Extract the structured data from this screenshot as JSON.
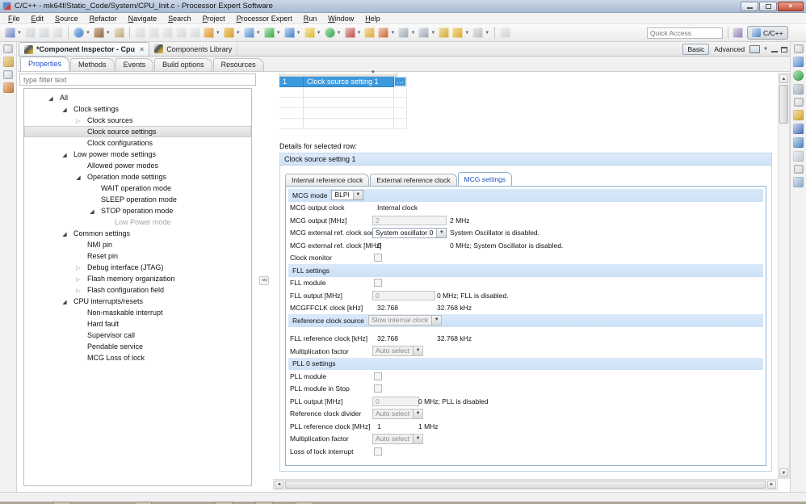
{
  "window": {
    "title": "C/C++ - mk64f/Static_Code/System/CPU_Init.c - Processor Expert Software"
  },
  "menu": {
    "items": [
      "File",
      "Edit",
      "Source",
      "Refactor",
      "Navigate",
      "Search",
      "Project",
      "Processor Expert",
      "Run",
      "Window",
      "Help"
    ]
  },
  "toolbar": {
    "quick_access_placeholder": "Quick Access",
    "perspective_label": "C/C++",
    "items": [
      {
        "name": "new-wizard",
        "dropdown": true
      },
      {
        "name": "save",
        "dim": true
      },
      {
        "name": "save-all",
        "dim": true
      },
      {
        "name": "print",
        "dim": true
      },
      {
        "sep": true
      },
      {
        "name": "debug-attach",
        "dropdown": true
      },
      {
        "name": "build",
        "dropdown": true
      },
      {
        "name": "make-target"
      },
      {
        "sep": true
      },
      {
        "name": "pencil",
        "dim": true
      },
      {
        "name": "format-brush",
        "dim": true
      },
      {
        "name": "spray",
        "dim": true
      },
      {
        "name": "mark-occurrences",
        "dim": true
      },
      {
        "name": "show-whitespace",
        "dim": true
      },
      {
        "name": "new-pe-project",
        "dropdown": true
      },
      {
        "name": "toolbox",
        "dropdown": true
      },
      {
        "name": "new-c-file",
        "dropdown": true
      },
      {
        "name": "coverage",
        "dropdown": true
      },
      {
        "name": "annotations",
        "dropdown": true
      },
      {
        "name": "external-tools",
        "dropdown": true
      },
      {
        "name": "run",
        "dropdown": true
      },
      {
        "name": "profile",
        "dropdown": true
      },
      {
        "name": "open-resource"
      },
      {
        "name": "highlighter",
        "dropdown": true
      },
      {
        "name": "prev-annotation",
        "dropdown": true
      },
      {
        "name": "next-annotation",
        "dropdown": true
      },
      {
        "name": "last-edit"
      },
      {
        "name": "back",
        "dropdown": true
      },
      {
        "name": "forward",
        "dropdown": true
      },
      {
        "sep": true
      },
      {
        "name": "pin-editor",
        "dim": true
      }
    ]
  },
  "left_strip": {
    "icons": [
      "restore-view",
      "project-explorer",
      "restore-view",
      "type-hierarchy"
    ]
  },
  "right_strip": {
    "icons": [
      "restore-view",
      "outline-view",
      "target-connections",
      "device-view",
      "restore-view",
      "problems-view",
      "tasks-view",
      "console-view",
      "memory-view",
      "restore-view",
      "split-editor"
    ]
  },
  "editor_tabs": [
    {
      "label": "*Component Inspector - Cpu",
      "active": true,
      "closable": true
    },
    {
      "label": "Components Library",
      "active": false,
      "closable": false
    }
  ],
  "view_toolbar": {
    "basic_label": "Basic",
    "advanced_label": "Advanced"
  },
  "inspector_tabs": [
    {
      "label": "Properties",
      "active": true
    },
    {
      "label": "Methods"
    },
    {
      "label": "Events"
    },
    {
      "label": "Build options"
    },
    {
      "label": "Resources"
    }
  ],
  "filter": {
    "placeholder": "type filter text"
  },
  "tree": {
    "items": [
      {
        "label": "All",
        "level": 0,
        "state": "expanded"
      },
      {
        "label": "Clock settings",
        "level": 1,
        "state": "expanded"
      },
      {
        "label": "Clock sources",
        "level": 2,
        "state": "collapsed"
      },
      {
        "label": "Clock source settings",
        "level": 2,
        "state": "leaf",
        "selected": true
      },
      {
        "label": "Clock configurations",
        "level": 2,
        "state": "leaf"
      },
      {
        "label": "Low power mode settings",
        "level": 1,
        "state": "expanded"
      },
      {
        "label": "Allowed power modes",
        "level": 2,
        "state": "leaf"
      },
      {
        "label": "Operation mode settings",
        "level": 2,
        "state": "expanded"
      },
      {
        "label": "WAIT operation mode",
        "level": 3,
        "state": "leaf"
      },
      {
        "label": "SLEEP operation mode",
        "level": 3,
        "state": "leaf"
      },
      {
        "label": "STOP operation mode",
        "level": 3,
        "state": "expanded"
      },
      {
        "label": "Low Power mode",
        "level": 4,
        "state": "leaf",
        "disabled": true
      },
      {
        "label": "Common settings",
        "level": 1,
        "state": "expanded"
      },
      {
        "label": "NMI pin",
        "level": 2,
        "state": "leaf"
      },
      {
        "label": "Reset pin",
        "level": 2,
        "state": "leaf"
      },
      {
        "label": "Debug interface (JTAG)",
        "level": 2,
        "state": "collapsed"
      },
      {
        "label": "Flash memory organization",
        "level": 2,
        "state": "collapsed"
      },
      {
        "label": "Flash configuration field",
        "level": 2,
        "state": "collapsed"
      },
      {
        "label": "CPU interrupts/resets",
        "level": 1,
        "state": "expanded"
      },
      {
        "label": "Non-maskable interrupt",
        "level": 2,
        "state": "leaf"
      },
      {
        "label": "Hard fault",
        "level": 2,
        "state": "leaf"
      },
      {
        "label": "Supervisor call",
        "level": 2,
        "state": "leaf"
      },
      {
        "label": "Pendable service",
        "level": 2,
        "state": "leaf"
      },
      {
        "label": "MCG Loss of lock",
        "level": 2,
        "state": "leaf"
      }
    ]
  },
  "grid": {
    "row": {
      "num": "1",
      "name": "Clock source setting 1",
      "more_label": "…"
    }
  },
  "splitter": {
    "collapse_label": "<<"
  },
  "details": {
    "caption": "Details for selected row:",
    "group_title": "Clock source setting 1",
    "tabs": [
      {
        "label": "Internal reference clock"
      },
      {
        "label": "External reference clock"
      },
      {
        "label": "MCG settings",
        "active": true
      }
    ],
    "rows": [
      {
        "type": "header-select",
        "label": "MCG mode",
        "value": "BLPI",
        "disabled": false
      },
      {
        "type": "text",
        "label": "MCG output clock",
        "value": "Internal clock",
        "comment": ""
      },
      {
        "type": "input",
        "label": "MCG output [MHz]",
        "value": "2",
        "comment": "2 MHz",
        "disabled": true
      },
      {
        "type": "select",
        "label": "MCG external ref. clock source",
        "value": "System oscillator 0",
        "comment": "System Oscillator is disabled.",
        "disabled": false
      },
      {
        "type": "text",
        "label": "MCG external ref. clock [MHz]",
        "value": "0",
        "comment": "0 MHz; System Oscillator is disabled."
      },
      {
        "type": "checkbox",
        "label": "Clock monitor",
        "checked": false
      },
      {
        "type": "section",
        "label": "FLL settings"
      },
      {
        "type": "checkbox",
        "label": "FLL module",
        "checked": false
      },
      {
        "type": "input",
        "label": "FLL output [MHz]",
        "value": "0",
        "comment": "0 MHz; FLL is disabled.",
        "disabled": true
      },
      {
        "type": "text",
        "label": "MCGFFCLK clock [kHz]",
        "value": "32.768",
        "comment": "32.768 kHz"
      },
      {
        "type": "header-select",
        "label": "Reference clock source",
        "value": "Slow internal clock",
        "disabled": true
      },
      {
        "type": "text",
        "label": "FLL reference clock [kHz]",
        "value": "32.768",
        "comment": "32.768 kHz"
      },
      {
        "type": "select",
        "label": "Multiplication factor",
        "value": "Auto select",
        "comment": "",
        "disabled": true
      },
      {
        "type": "section",
        "label": "PLL 0 settings"
      },
      {
        "type": "checkbox",
        "label": "PLL module",
        "checked": false
      },
      {
        "type": "checkbox",
        "label": "PLL module in Stop",
        "checked": false
      },
      {
        "type": "input",
        "label": "PLL output [MHz]",
        "value": "0",
        "comment": "0 MHz; PLL is disabled",
        "disabled": true
      },
      {
        "type": "select",
        "label": "Reference clock divider",
        "value": "Auto select",
        "comment": "",
        "disabled": true
      },
      {
        "type": "text",
        "label": "PLL reference clock [MHz]",
        "value": "1",
        "comment": "1 MHz"
      },
      {
        "type": "select",
        "label": "Multiplication factor",
        "value": "Auto select",
        "comment": "",
        "disabled": true
      },
      {
        "type": "checkbox",
        "label": "Loss of lock interrupt",
        "checked": false
      }
    ]
  }
}
